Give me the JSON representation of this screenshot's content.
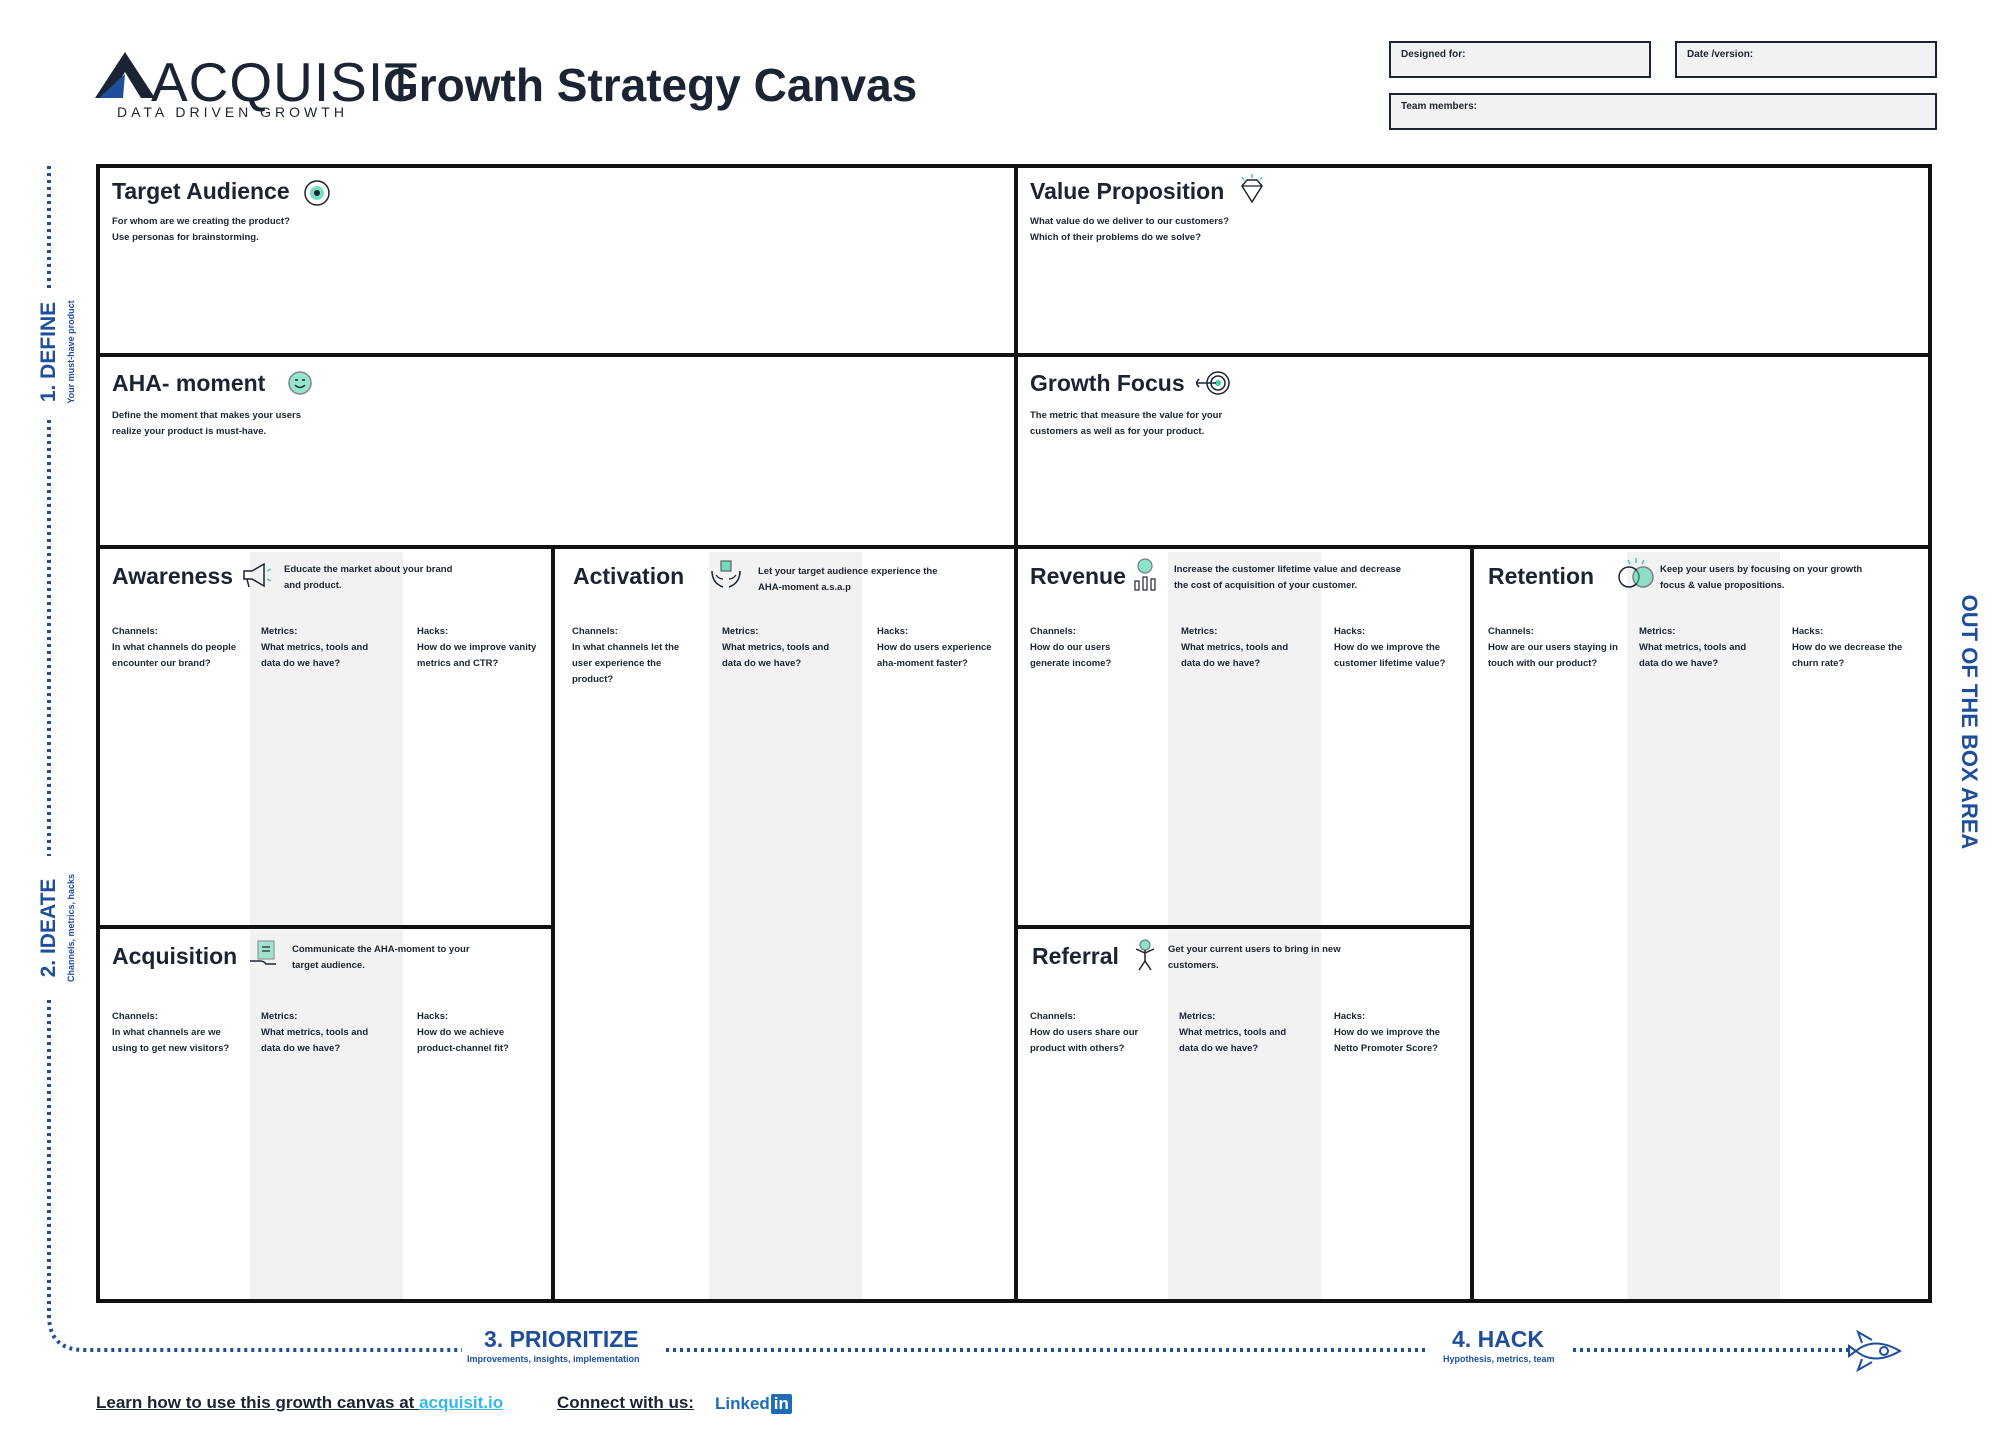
{
  "header": {
    "logo_word": "ACQUISIT",
    "logo_tagline": "DATA DRIVEN GROWTH",
    "title": "Growth Strategy Canvas",
    "designed_for_label": "Designed for:",
    "date_label": "Date /version:",
    "team_label": "Team members:"
  },
  "blocks": {
    "target_audience": {
      "title": "Target Audience",
      "desc": "For whom are we creating the product?\nUse personas for brainstorming."
    },
    "value_proposition": {
      "title": "Value Proposition",
      "desc": "What value do we deliver to our customers?\nWhich of their problems do we solve?"
    },
    "aha_moment": {
      "title": "AHA- moment",
      "desc": "Define the moment that makes your users\nrealize your product is must-have."
    },
    "growth_focus": {
      "title": "Growth Focus",
      "desc": "The metric that measure the value for your\ncustomers as well as for your product."
    },
    "awareness": {
      "title": "Awareness",
      "desc": "Educate the market about your brand\nand product.",
      "channels": "Channels:\nIn what channels do people\nencounter our brand?",
      "metrics": "Metrics:\nWhat metrics, tools and\ndata do we have?",
      "hacks": "Hacks:\nHow do we improve vanity\nmetrics and CTR?"
    },
    "activation": {
      "title": "Activation",
      "desc": "Let your target audience experience the\nAHA-moment a.s.a.p",
      "channels": "Channels:\nIn what channels let the\nuser experience the\nproduct?",
      "metrics": "Metrics:\nWhat metrics, tools and\ndata do we have?",
      "hacks": "Hacks:\nHow do users experience\naha-moment faster?"
    },
    "revenue": {
      "title": "Revenue",
      "desc": "Increase the customer lifetime value and decrease\nthe cost of acquisition of your customer.",
      "channels": "Channels:\nHow do our users\ngenerate income?",
      "metrics": "Metrics:\nWhat metrics, tools and\ndata do we have?",
      "hacks": "Hacks:\nHow do we improve the\ncustomer lifetime value?"
    },
    "retention": {
      "title": "Retention",
      "desc": "Keep your users by focusing on your growth\nfocus & value propositions.",
      "channels": "Channels:\nHow are our users staying in\ntouch with our product?",
      "metrics": "Metrics:\nWhat metrics, tools and\ndata do we have?",
      "hacks": "Hacks:\nHow do we decrease the\nchurn rate?"
    },
    "acquisition": {
      "title": "Acquisition",
      "desc": "Communicate the AHA-moment to your\ntarget audience.",
      "channels": "Channels:\nIn what channels are we\nusing to get new visitors?",
      "metrics": "Metrics:\nWhat metrics, tools and\ndata do we have?",
      "hacks": "Hacks:\nHow do we achieve\nproduct-channel fit?"
    },
    "referral": {
      "title": "Referral",
      "desc": "Get your current users to bring in new\ncustomers.",
      "channels": "Channels:\nHow do users share our\nproduct with others?",
      "metrics": "Metrics:\nWhat metrics, tools and\ndata do we have?",
      "hacks": "Hacks:\nHow do we improve the\nNetto Promoter Score?"
    }
  },
  "steps": {
    "define": "1. DEFINE",
    "define_sub": "Your must-have product",
    "ideate": "2. IDEATE",
    "ideate_sub": "Channels, metrics, hacks",
    "prioritize": "3. PRIORITIZE",
    "prioritize_sub": "Improvements, insights, implementation",
    "hack": "4. HACK",
    "hack_sub": "Hypothesis, metrics, team",
    "out_of_box": "OUT OF THE BOX AREA"
  },
  "footer": {
    "learn_text": "Learn how to use this growth canvas at ",
    "learn_link": "acquisit.io",
    "connect_text": "Connect with us:",
    "linkedin_word": "Linked",
    "linkedin_in": "in"
  },
  "colors": {
    "brand_blue": "#1e4e9c",
    "link_cyan": "#35b7e8",
    "ink": "#1b2433",
    "accent_green": "#3fd1a6"
  }
}
